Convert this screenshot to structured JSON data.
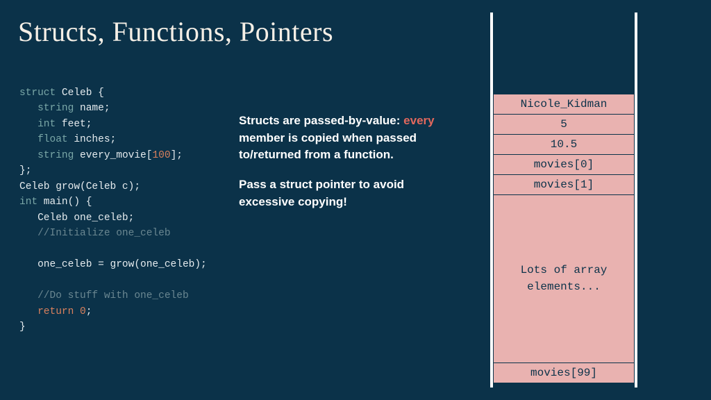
{
  "title": "Structs, Functions, Pointers",
  "code": {
    "l1_kw": "struct",
    "l1_rest": " Celeb {",
    "l2_kw": "string",
    "l2_rest": " name;",
    "l3_kw": "int",
    "l3_rest": " feet;",
    "l4_kw": "float",
    "l4_rest": " inches;",
    "l5_kw": "string",
    "l5_a": " every_movie[",
    "l5_num": "100",
    "l5_b": "];",
    "l6": "};",
    "l7": "Celeb grow(Celeb c);",
    "l8_kw": "int",
    "l8_rest": " main() {",
    "l9": "   Celeb one_celeb;",
    "l10": "   //Initialize one_celeb",
    "l11": "",
    "l12": "   one_celeb = grow(one_celeb);",
    "l13": "",
    "l14": "   //Do stuff with one_celeb",
    "l15_a": "   ",
    "l15_kw": "return",
    "l15_sp": " ",
    "l15_num": "0",
    "l15_b": ";",
    "l16": "}"
  },
  "para1": {
    "a": "Structs are passed-by-value: ",
    "accent": "every",
    "b": " member is copied when passed to/returned from a function."
  },
  "para2": "Pass a struct pointer to avoid excessive copying!",
  "memory": {
    "cells": [
      "Nicole_Kidman",
      "5",
      "10.5",
      "movies[0]",
      "movies[1]"
    ],
    "big": "Lots of array\nelements...",
    "last": "movies[99]"
  }
}
